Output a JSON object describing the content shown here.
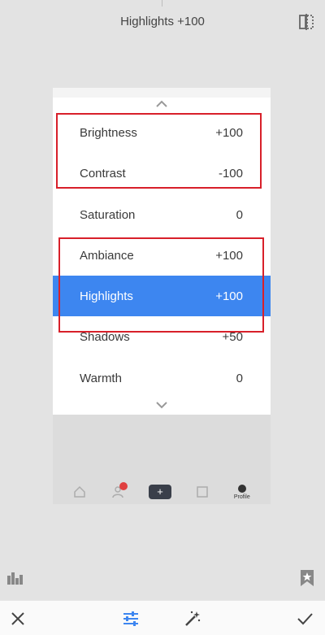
{
  "header": {
    "title": "Highlights +100"
  },
  "icons": {
    "compare": "compare-icon",
    "histogram": "histogram-icon",
    "bookmark": "bookmark-star-icon",
    "cancel": "close-icon",
    "adjust": "sliders-icon",
    "auto": "magic-wand-icon",
    "apply": "checkmark-icon"
  },
  "colors": {
    "accent": "#3d86f0",
    "highlight_box": "#d8202a"
  },
  "menu": {
    "items": [
      {
        "label": "Brightness",
        "value": "+100"
      },
      {
        "label": "Contrast",
        "value": "-100"
      },
      {
        "label": "Saturation",
        "value": "0"
      },
      {
        "label": "Ambiance",
        "value": "+100"
      },
      {
        "label": "Highlights",
        "value": "+100"
      },
      {
        "label": "Shadows",
        "value": "+50"
      },
      {
        "label": "Warmth",
        "value": "0"
      }
    ],
    "selected": "Highlights"
  },
  "preview_app": {
    "badge_count": "1",
    "profile_label": "Profile"
  }
}
